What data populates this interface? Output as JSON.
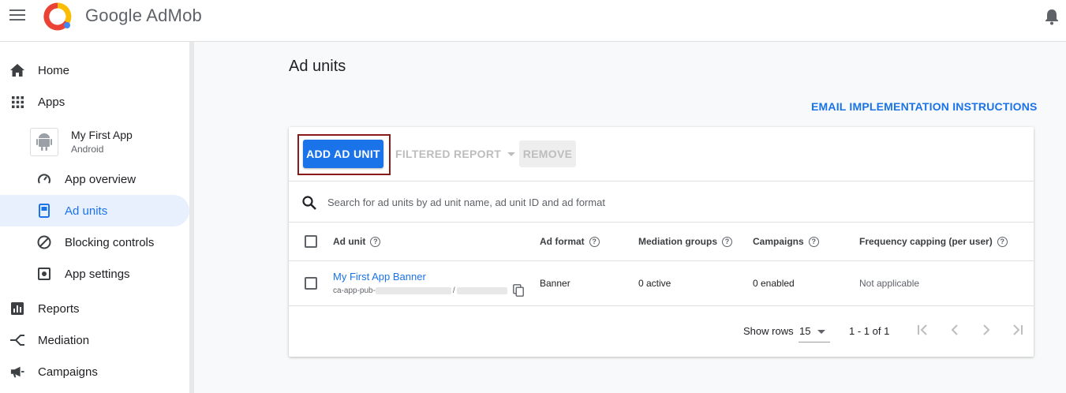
{
  "header": {
    "brand": "Google AdMob"
  },
  "sidebar": {
    "items": [
      {
        "label": "Home",
        "icon": "home-icon"
      },
      {
        "label": "Apps",
        "icon": "apps-grid-icon"
      }
    ],
    "app": {
      "name": "My First App",
      "platform": "Android"
    },
    "app_items": [
      {
        "label": "App overview",
        "icon": "gauge-icon"
      },
      {
        "label": "Ad units",
        "icon": "ad-unit-icon",
        "active": true
      },
      {
        "label": "Blocking controls",
        "icon": "block-icon"
      },
      {
        "label": "App settings",
        "icon": "settings-icon"
      }
    ],
    "bottom_items": [
      {
        "label": "Reports",
        "icon": "reports-icon"
      },
      {
        "label": "Mediation",
        "icon": "mediation-icon"
      },
      {
        "label": "Campaigns",
        "icon": "campaigns-icon"
      }
    ]
  },
  "main": {
    "title": "Ad units",
    "email_link": "EMAIL IMPLEMENTATION INSTRUCTIONS",
    "toolbar": {
      "add_label": "ADD AD UNIT",
      "filter_label": "FILTERED REPORT",
      "remove_label": "REMOVE"
    },
    "search": {
      "placeholder": "Search for ad units by ad unit name, ad unit ID and ad format"
    },
    "columns": [
      "Ad unit",
      "Ad format",
      "Mediation groups",
      "Campaigns",
      "Frequency capping (per user)"
    ],
    "rows": [
      {
        "name": "My First App Banner",
        "id_prefix": "ca-app-pub-",
        "id_sep": "/",
        "format": "Banner",
        "mediation": "0 active",
        "campaigns": "0 enabled",
        "frequency": "Not applicable"
      }
    ],
    "footer": {
      "rows_label": "Show rows",
      "rows_value": "15",
      "range": "1 - 1 of 1"
    }
  },
  "colors": {
    "accent": "#1a73e8",
    "highlight_border": "#8b1a1a"
  }
}
